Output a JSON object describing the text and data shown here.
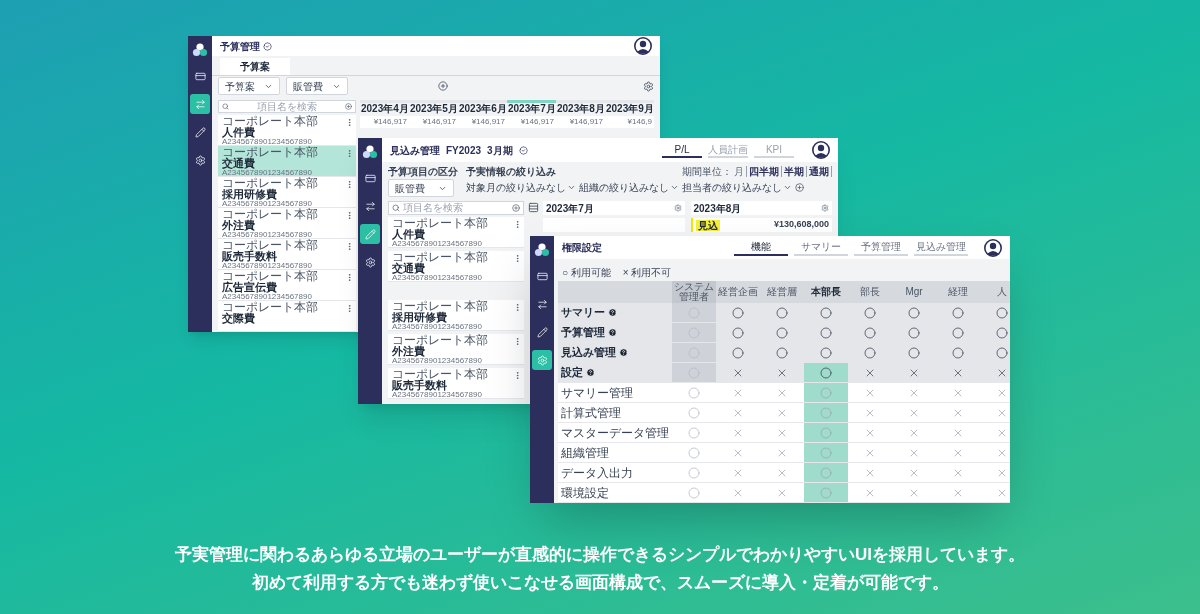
{
  "budget_window": {
    "title": "予算管理",
    "nav": [
      {
        "kind": "summary",
        "selected": false
      },
      {
        "kind": "budget",
        "selected": true
      },
      {
        "kind": "forecast",
        "selected": false
      },
      {
        "kind": "settings",
        "selected": false
      }
    ],
    "tabs": [
      {
        "label": "予算案",
        "selected": true
      }
    ],
    "filters": [
      "予算案",
      "販管費"
    ],
    "search": {
      "placeholder": "項目名を検索"
    },
    "months": [
      {
        "label": "2023年4月",
        "value": "¥146,917",
        "selected": false
      },
      {
        "label": "2023年5月",
        "value": "¥146,917",
        "selected": false
      },
      {
        "label": "2023年6月",
        "value": "¥146,917",
        "selected": false
      },
      {
        "label": "2023年7月",
        "value": "¥146,917",
        "selected": true
      },
      {
        "label": "2023年8月",
        "value": "¥146,917",
        "selected": false
      },
      {
        "label": "2023年9月",
        "value": "¥146,9",
        "selected": false
      }
    ],
    "items": [
      {
        "org": "コーポレート本部",
        "name": "人件費",
        "code": "A2345678901234567890",
        "selected": false
      },
      {
        "org": "コーポレート本部",
        "name": "交通費",
        "code": "A2345678901234567890",
        "selected": true
      },
      {
        "org": "コーポレート本部",
        "name": "採用研修費",
        "code": "A2345678901234567890",
        "selected": false
      },
      {
        "org": "コーポレート本部",
        "name": "外注費",
        "code": "A2345678901234567890",
        "selected": false
      },
      {
        "org": "コーポレート本部",
        "name": "販売手数料",
        "code": "A2345678901234567890",
        "selected": false
      },
      {
        "org": "コーポレート本部",
        "name": "広告宣伝費",
        "code": "A2345678901234567890",
        "selected": false
      },
      {
        "org": "コーポレート本部",
        "name": "交際費",
        "selected": false
      }
    ]
  },
  "forecast_window": {
    "title": "見込み管理",
    "fiscal_year": "FY2023",
    "period": "3月期",
    "nav": [
      {
        "kind": "summary",
        "selected": false
      },
      {
        "kind": "budget",
        "selected": false
      },
      {
        "kind": "forecast",
        "selected": true
      },
      {
        "kind": "settings",
        "selected": false
      }
    ],
    "tabs": [
      {
        "label": "P/L",
        "selected": true
      },
      {
        "label": "人員計画",
        "selected": false
      },
      {
        "label": "KPI",
        "selected": false
      }
    ],
    "category": {
      "label": "予算項目の区分",
      "value": "販管費"
    },
    "filter_label": "予実情報の絞り込み",
    "filters": [
      "対象月の絞り込みなし",
      "組織の絞り込みなし",
      "担当者の絞り込みなし"
    ],
    "period_unit": {
      "label": "期間単位：",
      "options": [
        {
          "label": "月",
          "selected": true
        },
        {
          "label": "四半期",
          "selected": false
        },
        {
          "label": "半期",
          "selected": false
        },
        {
          "label": "通期",
          "selected": false
        }
      ]
    },
    "search": {
      "placeholder": "項目名を検索"
    },
    "months": [
      {
        "label": "2023年7月"
      },
      {
        "label": "2023年8月",
        "tag": "見込",
        "value": "¥130,608,000"
      }
    ],
    "items": [
      {
        "org": "コーポレート本部",
        "name": "人件費",
        "code": "A2345678901234567890"
      },
      {
        "org": "コーポレート本部",
        "name": "交通費",
        "code": "A2345678901234567890"
      },
      {
        "org": "コーポレート本部",
        "name": "採用研修費",
        "code": "A2345678901234567890"
      },
      {
        "org": "コーポレート本部",
        "name": "外注費",
        "code": "A2345678901234567890"
      },
      {
        "org": "コーポレート本部",
        "name": "販売手数料",
        "code": "A2345678901234567890"
      }
    ]
  },
  "permission_window": {
    "title": "権限設定",
    "nav": [
      {
        "kind": "summary",
        "selected": false
      },
      {
        "kind": "budget",
        "selected": false
      },
      {
        "kind": "forecast",
        "selected": false
      },
      {
        "kind": "settings",
        "selected": true
      }
    ],
    "tabs": [
      {
        "label": "機能",
        "selected": true
      },
      {
        "label": "サマリー",
        "selected": false
      },
      {
        "label": "予算管理",
        "selected": false
      },
      {
        "label": "見込み管理",
        "selected": false
      }
    ],
    "legend": [
      {
        "symbol": "○",
        "label": "利用可能"
      },
      {
        "symbol": "×",
        "label": "利用不可"
      }
    ],
    "columns": [
      {
        "label": "システム管理者",
        "disabled": true,
        "highlighted": false
      },
      {
        "label": "経営企画",
        "disabled": false,
        "highlighted": false
      },
      {
        "label": "経営層",
        "disabled": false,
        "highlighted": false
      },
      {
        "label": "本部長",
        "disabled": false,
        "highlighted": true
      },
      {
        "label": "部長",
        "disabled": false,
        "highlighted": false
      },
      {
        "label": "Mgr",
        "disabled": false,
        "highlighted": false
      },
      {
        "label": "経理",
        "disabled": false,
        "highlighted": false
      },
      {
        "label": "人",
        "disabled": false,
        "highlighted": false
      }
    ],
    "rows": [
      {
        "label": "サマリー",
        "help": true,
        "expanded": false,
        "cells": [
          true,
          true,
          true,
          true,
          true,
          true,
          true,
          true
        ]
      },
      {
        "label": "予算管理",
        "help": true,
        "expanded": false,
        "cells": [
          true,
          true,
          true,
          true,
          true,
          true,
          true,
          true
        ]
      },
      {
        "label": "見込み管理",
        "help": true,
        "expanded": false,
        "cells": [
          true,
          true,
          true,
          true,
          true,
          true,
          true,
          true
        ]
      },
      {
        "label": "設定",
        "help": true,
        "expanded": true,
        "cells": [
          true,
          false,
          false,
          true,
          false,
          false,
          false,
          false
        ],
        "children": [
          {
            "label": "サマリー管理",
            "cells": [
              true,
              false,
              false,
              true,
              false,
              false,
              false,
              false
            ]
          },
          {
            "label": "計算式管理",
            "cells": [
              true,
              false,
              false,
              true,
              false,
              false,
              false,
              false
            ]
          },
          {
            "label": "マスターデータ管理",
            "cells": [
              true,
              false,
              false,
              true,
              false,
              false,
              false,
              false
            ]
          },
          {
            "label": "組織管理",
            "cells": [
              true,
              false,
              false,
              true,
              false,
              false,
              false,
              false
            ]
          },
          {
            "label": "データ入出力",
            "cells": [
              true,
              false,
              false,
              true,
              false,
              false,
              false,
              false
            ]
          },
          {
            "label": "環境設定",
            "cells": [
              true,
              false,
              false,
              true,
              false,
              false,
              false,
              false
            ]
          }
        ]
      }
    ]
  },
  "caption": [
    "予実管理に関わるあらゆる立場のユーザーが直感的に操作できるシンプルでわかりやすいUIを採用しています。",
    "初めて利用する方でも迷わず使いこなせる画面構成で、スムーズに導入・定着が可能です。"
  ]
}
